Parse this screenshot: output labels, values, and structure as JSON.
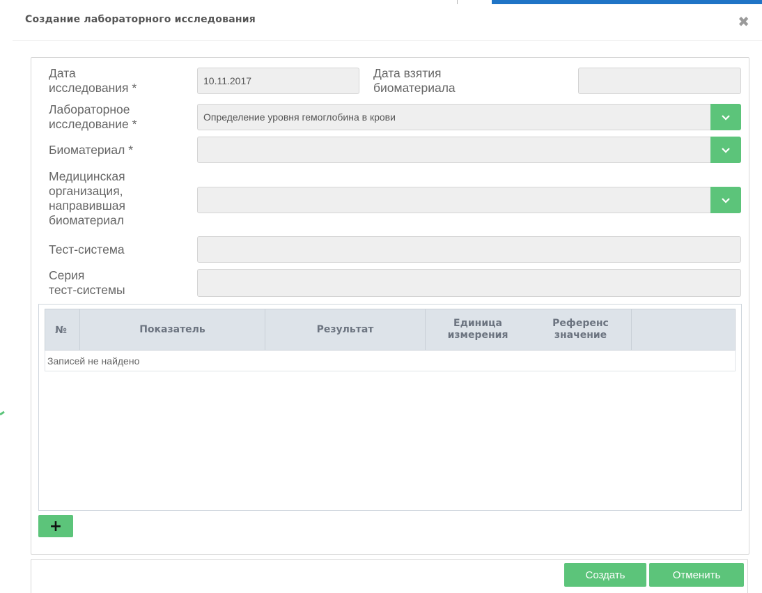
{
  "dialog": {
    "title": "Создание лабораторного исследования",
    "close_icon": "close-icon"
  },
  "form": {
    "study_date": {
      "label_line1": "Дата",
      "label_line2": "исследования *",
      "value": "10.11.2017"
    },
    "biomaterial_date": {
      "label_line1": "Дата взятия",
      "label_line2": "биоматериала",
      "value": ""
    },
    "lab_study": {
      "label_line1": "Лабораторное",
      "label_line2": "исследование *",
      "value": "Определение уровня гемоглобина в крови"
    },
    "biomaterial": {
      "label": "Биоматериал *",
      "value": ""
    },
    "medical_org": {
      "label_line1": "Медицинская",
      "label_line2": "организация,",
      "label_line3": "направившая",
      "label_line4": "биоматериал",
      "value": ""
    },
    "test_system": {
      "label": "Тест-система",
      "value": ""
    },
    "test_series": {
      "label_line1": "Серия",
      "label_line2": "тест-системы",
      "value": ""
    }
  },
  "grid": {
    "columns": [
      {
        "line1": "№",
        "line2": ""
      },
      {
        "line1": "Показатель",
        "line2": ""
      },
      {
        "line1": "Результат",
        "line2": ""
      },
      {
        "line1": "Единица",
        "line2": "измерения"
      },
      {
        "line1": "Референс",
        "line2": "значение"
      },
      {
        "line1": "",
        "line2": ""
      }
    ],
    "empty_text": "Записей не найдено"
  },
  "add_button": {
    "label": "+"
  },
  "footer": {
    "create_label": "Создать",
    "cancel_label": "Отменить"
  },
  "colors": {
    "accent_green": "#5cc47a",
    "top_strip_blue": "#1f74c6",
    "header_bg": "#dde3e9"
  }
}
